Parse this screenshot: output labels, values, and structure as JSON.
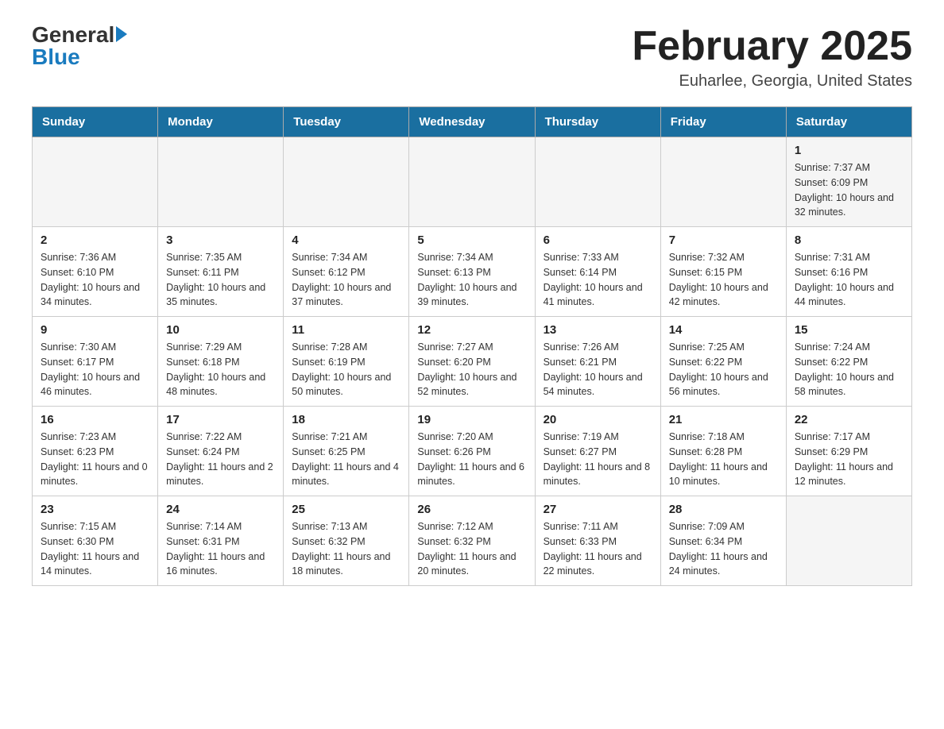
{
  "header": {
    "logo_general": "General",
    "logo_blue": "Blue",
    "title": "February 2025",
    "subtitle": "Euharlee, Georgia, United States"
  },
  "days_of_week": [
    "Sunday",
    "Monday",
    "Tuesday",
    "Wednesday",
    "Thursday",
    "Friday",
    "Saturday"
  ],
  "weeks": [
    [
      {
        "day": "",
        "sunrise": "",
        "sunset": "",
        "daylight": ""
      },
      {
        "day": "",
        "sunrise": "",
        "sunset": "",
        "daylight": ""
      },
      {
        "day": "",
        "sunrise": "",
        "sunset": "",
        "daylight": ""
      },
      {
        "day": "",
        "sunrise": "",
        "sunset": "",
        "daylight": ""
      },
      {
        "day": "",
        "sunrise": "",
        "sunset": "",
        "daylight": ""
      },
      {
        "day": "",
        "sunrise": "",
        "sunset": "",
        "daylight": ""
      },
      {
        "day": "1",
        "sunrise": "Sunrise: 7:37 AM",
        "sunset": "Sunset: 6:09 PM",
        "daylight": "Daylight: 10 hours and 32 minutes."
      }
    ],
    [
      {
        "day": "2",
        "sunrise": "Sunrise: 7:36 AM",
        "sunset": "Sunset: 6:10 PM",
        "daylight": "Daylight: 10 hours and 34 minutes."
      },
      {
        "day": "3",
        "sunrise": "Sunrise: 7:35 AM",
        "sunset": "Sunset: 6:11 PM",
        "daylight": "Daylight: 10 hours and 35 minutes."
      },
      {
        "day": "4",
        "sunrise": "Sunrise: 7:34 AM",
        "sunset": "Sunset: 6:12 PM",
        "daylight": "Daylight: 10 hours and 37 minutes."
      },
      {
        "day": "5",
        "sunrise": "Sunrise: 7:34 AM",
        "sunset": "Sunset: 6:13 PM",
        "daylight": "Daylight: 10 hours and 39 minutes."
      },
      {
        "day": "6",
        "sunrise": "Sunrise: 7:33 AM",
        "sunset": "Sunset: 6:14 PM",
        "daylight": "Daylight: 10 hours and 41 minutes."
      },
      {
        "day": "7",
        "sunrise": "Sunrise: 7:32 AM",
        "sunset": "Sunset: 6:15 PM",
        "daylight": "Daylight: 10 hours and 42 minutes."
      },
      {
        "day": "8",
        "sunrise": "Sunrise: 7:31 AM",
        "sunset": "Sunset: 6:16 PM",
        "daylight": "Daylight: 10 hours and 44 minutes."
      }
    ],
    [
      {
        "day": "9",
        "sunrise": "Sunrise: 7:30 AM",
        "sunset": "Sunset: 6:17 PM",
        "daylight": "Daylight: 10 hours and 46 minutes."
      },
      {
        "day": "10",
        "sunrise": "Sunrise: 7:29 AM",
        "sunset": "Sunset: 6:18 PM",
        "daylight": "Daylight: 10 hours and 48 minutes."
      },
      {
        "day": "11",
        "sunrise": "Sunrise: 7:28 AM",
        "sunset": "Sunset: 6:19 PM",
        "daylight": "Daylight: 10 hours and 50 minutes."
      },
      {
        "day": "12",
        "sunrise": "Sunrise: 7:27 AM",
        "sunset": "Sunset: 6:20 PM",
        "daylight": "Daylight: 10 hours and 52 minutes."
      },
      {
        "day": "13",
        "sunrise": "Sunrise: 7:26 AM",
        "sunset": "Sunset: 6:21 PM",
        "daylight": "Daylight: 10 hours and 54 minutes."
      },
      {
        "day": "14",
        "sunrise": "Sunrise: 7:25 AM",
        "sunset": "Sunset: 6:22 PM",
        "daylight": "Daylight: 10 hours and 56 minutes."
      },
      {
        "day": "15",
        "sunrise": "Sunrise: 7:24 AM",
        "sunset": "Sunset: 6:22 PM",
        "daylight": "Daylight: 10 hours and 58 minutes."
      }
    ],
    [
      {
        "day": "16",
        "sunrise": "Sunrise: 7:23 AM",
        "sunset": "Sunset: 6:23 PM",
        "daylight": "Daylight: 11 hours and 0 minutes."
      },
      {
        "day": "17",
        "sunrise": "Sunrise: 7:22 AM",
        "sunset": "Sunset: 6:24 PM",
        "daylight": "Daylight: 11 hours and 2 minutes."
      },
      {
        "day": "18",
        "sunrise": "Sunrise: 7:21 AM",
        "sunset": "Sunset: 6:25 PM",
        "daylight": "Daylight: 11 hours and 4 minutes."
      },
      {
        "day": "19",
        "sunrise": "Sunrise: 7:20 AM",
        "sunset": "Sunset: 6:26 PM",
        "daylight": "Daylight: 11 hours and 6 minutes."
      },
      {
        "day": "20",
        "sunrise": "Sunrise: 7:19 AM",
        "sunset": "Sunset: 6:27 PM",
        "daylight": "Daylight: 11 hours and 8 minutes."
      },
      {
        "day": "21",
        "sunrise": "Sunrise: 7:18 AM",
        "sunset": "Sunset: 6:28 PM",
        "daylight": "Daylight: 11 hours and 10 minutes."
      },
      {
        "day": "22",
        "sunrise": "Sunrise: 7:17 AM",
        "sunset": "Sunset: 6:29 PM",
        "daylight": "Daylight: 11 hours and 12 minutes."
      }
    ],
    [
      {
        "day": "23",
        "sunrise": "Sunrise: 7:15 AM",
        "sunset": "Sunset: 6:30 PM",
        "daylight": "Daylight: 11 hours and 14 minutes."
      },
      {
        "day": "24",
        "sunrise": "Sunrise: 7:14 AM",
        "sunset": "Sunset: 6:31 PM",
        "daylight": "Daylight: 11 hours and 16 minutes."
      },
      {
        "day": "25",
        "sunrise": "Sunrise: 7:13 AM",
        "sunset": "Sunset: 6:32 PM",
        "daylight": "Daylight: 11 hours and 18 minutes."
      },
      {
        "day": "26",
        "sunrise": "Sunrise: 7:12 AM",
        "sunset": "Sunset: 6:32 PM",
        "daylight": "Daylight: 11 hours and 20 minutes."
      },
      {
        "day": "27",
        "sunrise": "Sunrise: 7:11 AM",
        "sunset": "Sunset: 6:33 PM",
        "daylight": "Daylight: 11 hours and 22 minutes."
      },
      {
        "day": "28",
        "sunrise": "Sunrise: 7:09 AM",
        "sunset": "Sunset: 6:34 PM",
        "daylight": "Daylight: 11 hours and 24 minutes."
      },
      {
        "day": "",
        "sunrise": "",
        "sunset": "",
        "daylight": ""
      }
    ]
  ]
}
